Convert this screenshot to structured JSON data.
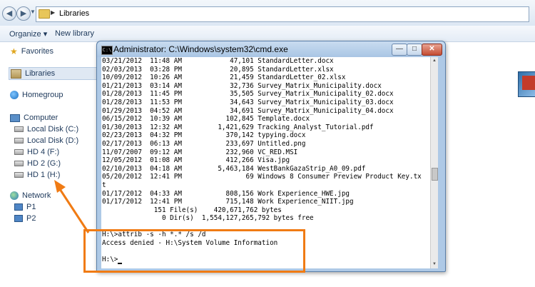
{
  "addressbar": {
    "path": "Libraries"
  },
  "toolbar": {
    "organize": "Organize ▾",
    "new_library": "New library"
  },
  "nav": {
    "favorites": "Favorites",
    "libraries": "Libraries",
    "homegroup": "Homegroup",
    "computer": "Computer",
    "drives": [
      "Local Disk (C:)",
      "Local Disk (D:)",
      "HD 4 (F:)",
      "HD 2 (G:)",
      "HD 1 (H:)"
    ],
    "network": "Network",
    "network_items": [
      "P1",
      "P2"
    ]
  },
  "cmd": {
    "title": "Administrator: C:\\Windows\\system32\\cmd.exe",
    "listing": [
      "03/21/2012  11:48 AM            47,101 StandardLetter.docx",
      "02/03/2013  03:28 PM            20,895 StandardLetter.xlsx",
      "10/09/2012  10:26 AM            21,459 StandardLetter_02.xlsx",
      "01/21/2013  03:14 AM            32,736 Survey_Matrix_Municipality.docx",
      "01/28/2013  11:45 PM            35,505 Survey_Matrix_Municipality_02.docx",
      "01/28/2013  11:53 PM            34,643 Survey_Matrix_Municipality_03.docx",
      "01/29/2013  04:52 AM            34,691 Survey_Matrix_Municipality_04.docx",
      "06/15/2012  10:39 AM           102,845 Template.docx",
      "01/30/2013  12:32 AM         1,421,629 Tracking_Analyst_Tutorial.pdf",
      "02/23/2013  04:32 PM           370,142 typying.docx",
      "02/17/2013  06:13 AM           233,697 Untitled.png",
      "11/07/2007  09:12 AM           232,960 VC_RED.MSI",
      "12/05/2012  01:08 AM           412,266 Visa.jpg",
      "02/10/2013  04:18 AM         5,463,184 WestBankGazaStrip_A0_09.pdf",
      "05/20/2012  12:41 PM                69 Windows 8 Consumer Preview Product Key.tx",
      "t",
      "01/17/2012  04:33 AM           808,156 Work Experience_HWE.jpg",
      "01/17/2012  12:41 PM           715,148 Work Experience_NIIT.jpg",
      "             151 File(s)    420,671,762 bytes",
      "               0 Dir(s)  1,554,127,265,792 bytes free",
      "",
      "H:\\>attrib -s -h *.* /s /d",
      "Access denied - H:\\System Volume Information",
      "",
      "H:\\>"
    ]
  },
  "annotation": {
    "color": "#f07b14"
  }
}
